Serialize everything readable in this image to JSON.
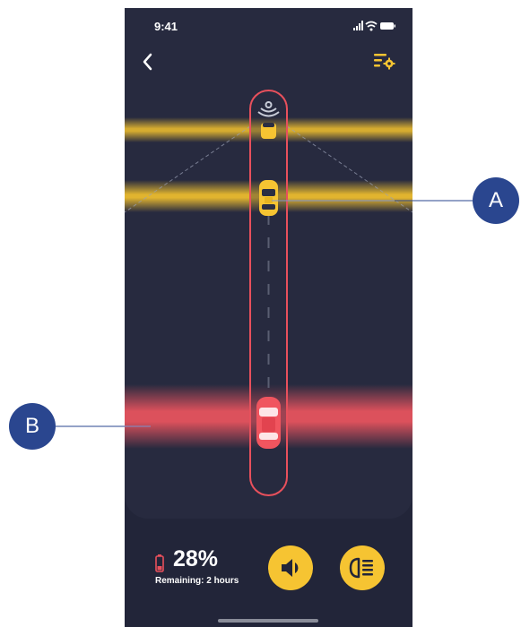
{
  "status_bar": {
    "time": "9:41"
  },
  "header": {
    "back_icon": "chevron-left-icon",
    "settings_icon": "filter-settings-icon"
  },
  "footer": {
    "battery_percent": "28%",
    "remaining_text": "Remaining: 2 hours",
    "sound_button_icon": "speaker-icon",
    "light_button_icon": "headlight-icon"
  },
  "callouts": {
    "a_label": "A",
    "b_label": "B"
  },
  "colors": {
    "background": "#222539",
    "road_area": "#272a3f",
    "accent_yellow": "#f6c432",
    "alert_red": "#f0555f",
    "callout_blue": "#2a468f"
  }
}
